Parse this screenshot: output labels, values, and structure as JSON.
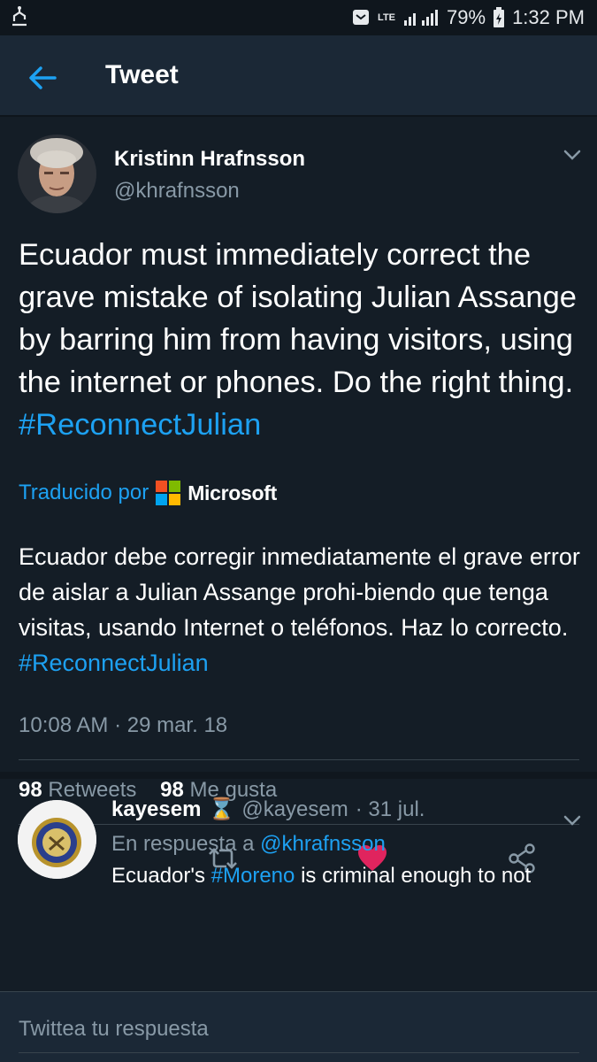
{
  "status_bar": {
    "network": "LTE",
    "battery": "79%",
    "time": "1:32 PM",
    "icons": [
      "usb-icon",
      "messenger-icon",
      "signal-icon",
      "battery-icon"
    ]
  },
  "header": {
    "title": "Tweet",
    "back_icon": "arrow-left-icon"
  },
  "tweet": {
    "author_name": "Kristinn Hrafnsson",
    "author_handle": "@khrafnsson",
    "text": "Ecuador must immediately correct the grave mistake of isolating Julian Assange by barring him from having visitors, using the internet or phones. Do the right thing.",
    "hashtag": "#ReconnectJulian",
    "translated_label": "Traducido por",
    "translator": "Microsoft",
    "translation_text": "Ecuador debe corregir inmediatamente el grave error de aislar a Julian Assange prohi-biendo que tenga visitas, usando Internet o teléfonos. Haz lo correcto.",
    "translation_hashtag": "#ReconnectJulian",
    "timestamp": "10:08 AM · 29 mar. 18",
    "retweets_count": "98",
    "retweets_label": "Retweets",
    "likes_count": "98",
    "likes_label": "Me gusta",
    "accent_color": "#1da1f2",
    "like_color": "#e0245e"
  },
  "reply": {
    "author_name": "kayesem",
    "author_emoji": "⌛",
    "author_handle": "@kayesem",
    "date": "· 31 jul.",
    "reply_to_label": "En respuesta a",
    "reply_to_handle": "@khrafnsson",
    "text_start": "Ecuador's",
    "text_hashtag": "#Moreno",
    "text_rest": "is criminal enough to not"
  },
  "compose": {
    "placeholder": "Twittea tu respuesta"
  }
}
